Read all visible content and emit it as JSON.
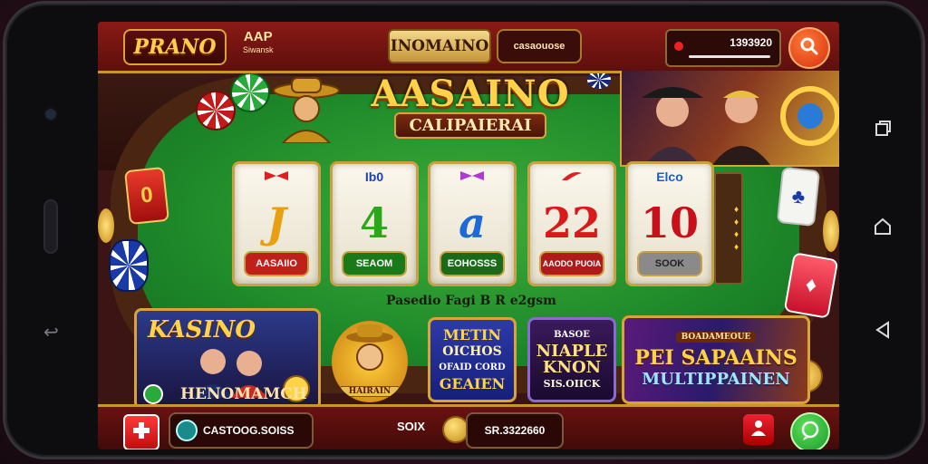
{
  "topbar": {
    "logo_text": "PRANO",
    "app_label": "AAP",
    "app_sublabel": "Siwansk",
    "title": "INOMAINO",
    "code": "casaouose",
    "balance": "1393920",
    "search_icon": "search-icon"
  },
  "hero": {
    "title": "AASAINO",
    "subtitle": "CALIPAIERAI"
  },
  "reels": [
    {
      "top": "",
      "symbol": "J",
      "button": "AASAIIO",
      "symbol_color": "#e8a010",
      "button_color": "#c0201a",
      "top_color": "#e02020"
    },
    {
      "top": "Ib0",
      "symbol": "4",
      "button": "SEAOM",
      "symbol_color": "#2aa81a",
      "button_color": "#1a7a1a",
      "top_color": "#1a40c0"
    },
    {
      "top": "",
      "symbol": "a",
      "button": "EOHOSSS",
      "symbol_color": "#1a6ad8",
      "button_color": "#1a6a1a",
      "top_color": "#b03ad0"
    },
    {
      "top": "",
      "symbol": "22",
      "button": "AAODO PUOIA",
      "symbol_color": "#d81a1a",
      "button_color": "#b01a1a",
      "top_color": "#e02020"
    },
    {
      "top": "Elco",
      "symbol": "10",
      "button": "SOOK",
      "symbol_color": "#c8101a",
      "button_color": "#8a8a8a",
      "top_color": "#1a60c0"
    }
  ],
  "table_caption": "Pasedio Fagi B R e2gsm",
  "banners": {
    "kasino_title": "KASINO",
    "kasino_bottom": "HENOMAMCH",
    "mascot_label": "HAIRAIN",
    "metin_l1": "METIN",
    "metin_l2": "OICHOS",
    "metin_l3": "OFAID CORD",
    "metin_l4": "GEAIEN",
    "naple_l1": "BASOE",
    "naple_l2": "NIAPLE",
    "naple_l3": "KNON",
    "naple_l4": "SIS.OIICK",
    "multi_l1": "BOADAMEOUE",
    "multi_l2": "PEI SAPAAINS",
    "multi_l3": "MULTIPPAINEN"
  },
  "bottombar": {
    "plus_icon": "medical-cross-icon",
    "account_text": "CASTOOG.SOISS",
    "coin_label": "SOIX",
    "coins": "SR.3322660",
    "person_icon": "person-icon",
    "chat_icon": "chat-icon"
  },
  "colors": {
    "topbar": "#8a1a16",
    "gold": "#d9a33a",
    "felt": "#2a9a30"
  }
}
